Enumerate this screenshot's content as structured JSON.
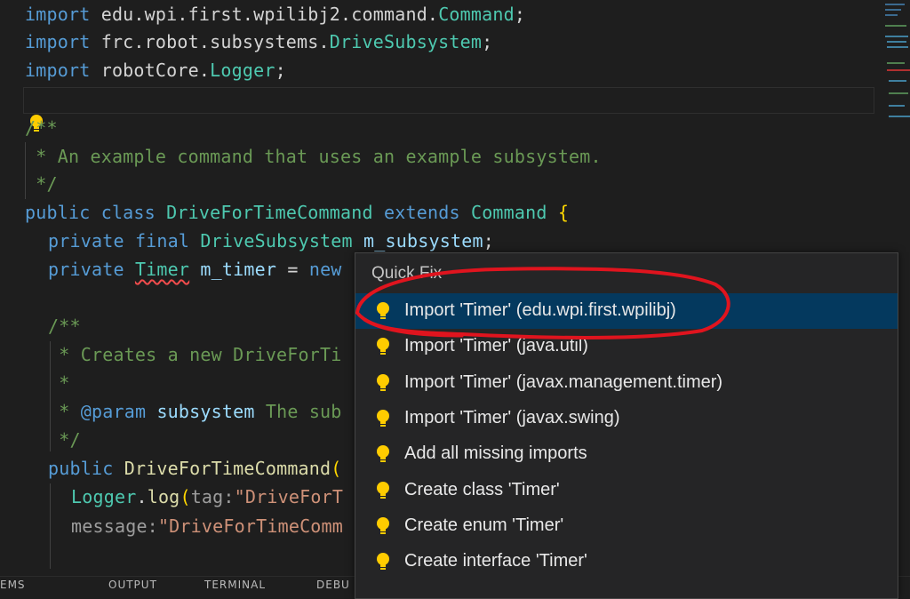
{
  "code": {
    "import1": {
      "kw": "import",
      "path": "edu.wpi.first.wpilibj2.command.",
      "cls": "Command",
      "semi": ";"
    },
    "import2": {
      "kw": "import",
      "path": "frc.robot.subsystems.",
      "cls": "DriveSubsystem",
      "semi": ";"
    },
    "import3": {
      "kw": "import",
      "path": "robotCore.",
      "cls": "Logger",
      "semi": ";"
    },
    "doc1": {
      "open": "/**",
      "star": " * ",
      "text": "An example command that uses an example subsystem.",
      "close": " */"
    },
    "class_decl": {
      "public": "public",
      "class": "class",
      "name": "DriveForTimeCommand",
      "extends": "extends",
      "parent": "Command",
      "brace": "{"
    },
    "field1": {
      "private": "private",
      "final": "final",
      "type": "DriveSubsystem",
      "name": "m_subsystem",
      "semi": ";"
    },
    "field2": {
      "private": "private",
      "type": "Timer",
      "name": "m_timer",
      "eq": " = ",
      "new": "new"
    },
    "doc2": {
      "open": "/**",
      "line1": " * Creates a new DriveForTi",
      "line2": " *",
      "line3_star": " * ",
      "param": "@param",
      "arg": "subsystem",
      "text": " The sub",
      "close": " */"
    },
    "ctor": {
      "public": "public",
      "name": "DriveForTimeCommand",
      "paren": "("
    },
    "logcall": {
      "obj": "Logger",
      "dot": ".",
      "fn": "log",
      "paren": "(",
      "hint1": "tag:",
      "str1": "\"DriveForT"
    },
    "logcall2": {
      "hint2": "message:",
      "str2": "\"DriveForTimeComm"
    }
  },
  "quickfix": {
    "title": "Quick Fix",
    "items": [
      {
        "label": "Import 'Timer' (edu.wpi.first.wpilibj)",
        "selected": true,
        "icon": "lightbulb-icon"
      },
      {
        "label": "Import 'Timer' (java.util)",
        "selected": false,
        "icon": "lightbulb-icon"
      },
      {
        "label": "Import 'Timer' (javax.management.timer)",
        "selected": false,
        "icon": "lightbulb-icon"
      },
      {
        "label": "Import 'Timer' (javax.swing)",
        "selected": false,
        "icon": "lightbulb-icon"
      },
      {
        "label": "Add all missing imports",
        "selected": false,
        "icon": "lightbulb-icon"
      },
      {
        "label": "Create class 'Timer'",
        "selected": false,
        "icon": "lightbulb-icon"
      },
      {
        "label": "Create enum 'Timer'",
        "selected": false,
        "icon": "lightbulb-icon"
      },
      {
        "label": "Create interface 'Timer'",
        "selected": false,
        "icon": "lightbulb-icon"
      }
    ]
  },
  "panel": {
    "tab1": "EMS",
    "tab2": "OUTPUT",
    "tab3": "TERMINAL",
    "tab4": "DEBU"
  },
  "colors": {
    "keyword": "#569cd6",
    "type": "#4ec9b0",
    "comment": "#6a9955",
    "string": "#ce9178",
    "selection": "#04395e",
    "annotation": "#e0141e"
  }
}
